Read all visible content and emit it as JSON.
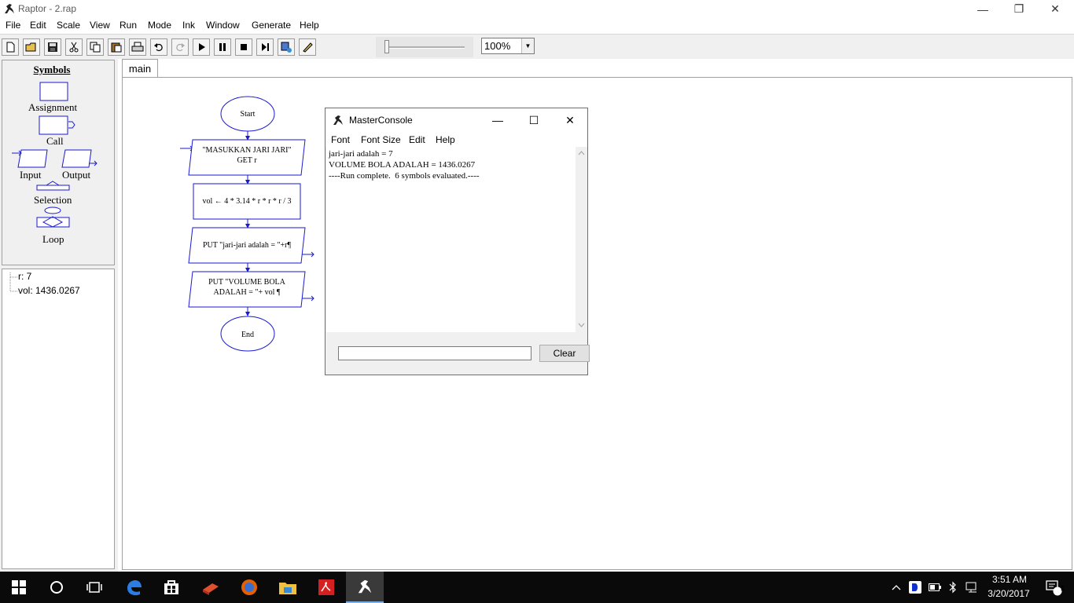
{
  "window": {
    "title": "Raptor - 2.rap",
    "controls": {
      "minimize": "—",
      "restore": "❐",
      "close": "✕"
    }
  },
  "menu": [
    "File",
    "Edit",
    "Scale",
    "View",
    "Run",
    "Mode",
    "Ink",
    "Window",
    "Generate",
    "Help"
  ],
  "toolbar": {
    "buttons": [
      "new-icon",
      "open-icon",
      "save-icon",
      "cut-icon",
      "copy-icon",
      "paste-icon",
      "print-icon",
      "undo-icon",
      "redo-icon",
      "play-icon",
      "pause-icon",
      "stop-icon",
      "step-icon",
      "test-server-icon",
      "pen-icon"
    ],
    "zoom_value": "100%",
    "speed_level": 0
  },
  "symbols": {
    "title": "Symbols",
    "items": [
      "Assignment",
      "Call",
      "Input",
      "Output",
      "Selection",
      "Loop"
    ]
  },
  "variables": [
    "r: 7",
    "vol: 1436.0267"
  ],
  "tabs": [
    "main"
  ],
  "flowchart": {
    "start": "Start",
    "input_prompt": "\"MASUKKAN JARI JARI\"",
    "input_var": "GET r",
    "assignment": "vol ← 4 * 3.14 * r * r * r / 3",
    "output1": "PUT \"jari-jari adalah = \"+r¶",
    "output2_line1": "PUT \"VOLUME BOLA",
    "output2_line2": "ADALAH = \"+ vol ¶",
    "end": "End"
  },
  "console": {
    "title": "MasterConsole",
    "menu": [
      "Font",
      "Font Size",
      "Edit",
      "Help"
    ],
    "output": [
      "jari-jari adalah = 7",
      "VOLUME BOLA ADALAH = 1436.0267",
      "----Run complete.  6 symbols evaluated.----"
    ],
    "input_value": "",
    "clear_label": "Clear",
    "controls": {
      "minimize": "—",
      "maximize": "☐",
      "close": "✕"
    }
  },
  "taskbar": {
    "apps": [
      "windows-start-icon",
      "cortana-icon",
      "task-view-icon",
      "edge-icon",
      "store-icon",
      "book-app-icon",
      "firefox-icon",
      "file-explorer-icon",
      "pdf-reader-icon",
      "raptor-icon"
    ],
    "tray": [
      "show-hidden-icons",
      "dashlane-icon",
      "battery-icon",
      "bluetooth-icon",
      "network-icon"
    ],
    "time": "3:51 AM",
    "date": "3/20/2017",
    "notification_count": "1"
  }
}
